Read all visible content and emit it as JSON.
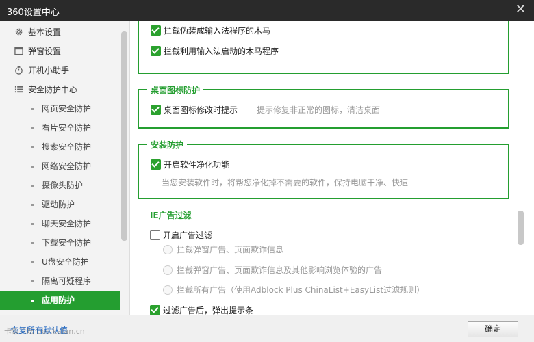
{
  "window": {
    "title": "360设置中心",
    "close_icon": "close-icon"
  },
  "sidebar": {
    "top_items": [
      {
        "label": "基本设置",
        "icon": "gear-icon"
      },
      {
        "label": "弹窗设置",
        "icon": "window-icon"
      },
      {
        "label": "开机小助手",
        "icon": "stopwatch-icon"
      },
      {
        "label": "安全防护中心",
        "icon": "list-icon"
      }
    ],
    "sub_items": [
      {
        "label": "网页安全防护"
      },
      {
        "label": "看片安全防护"
      },
      {
        "label": "搜索安全防护"
      },
      {
        "label": "网络安全防护"
      },
      {
        "label": "摄像头防护"
      },
      {
        "label": "驱动防护"
      },
      {
        "label": "聊天安全防护"
      },
      {
        "label": "下载安全防护"
      },
      {
        "label": "U盘安全防护"
      },
      {
        "label": "隔离可疑程序"
      },
      {
        "label": "应用防护",
        "active": true
      }
    ]
  },
  "input_method": {
    "items": [
      {
        "label": "拦截伪装成输入法程序的木马",
        "checked": true
      },
      {
        "label": "拦截利用输入法启动的木马程序",
        "checked": true
      }
    ]
  },
  "desktop_icon": {
    "title": "桌面图标防护",
    "item": {
      "label": "桌面图标修改时提示",
      "checked": true,
      "hint": "提示修复非正常的图标，清洁桌面"
    }
  },
  "install": {
    "title": "安装防护",
    "item": {
      "label": "开启软件净化功能",
      "checked": true
    },
    "desc": "当您安装软件时，将帮您净化掉不需要的软件，保持电脑干净、快速"
  },
  "ie_filter": {
    "title": "IE广告过滤",
    "enable": {
      "label": "开启广告过滤",
      "checked": false
    },
    "options": [
      {
        "label": "拦截弹窗广告、页面欺诈信息",
        "selected": true
      },
      {
        "label": "拦截弹窗广告、页面欺诈信息及其他影响浏览体验的广告",
        "selected": false
      },
      {
        "label": "拦截所有广告（使用Adblock Plus ChinaList+EasyList过滤规则）",
        "selected": false
      }
    ],
    "popup": {
      "label": "过滤广告后，弹出提示条",
      "checked": true
    }
  },
  "footer": {
    "reset_label": "恢复所有默认值",
    "ok_label": "确定"
  },
  "watermark": "卡饭论坛 bbs.kafan.cn",
  "colors": {
    "accent": "#249e30",
    "titlebar": "#2a2a2a"
  }
}
